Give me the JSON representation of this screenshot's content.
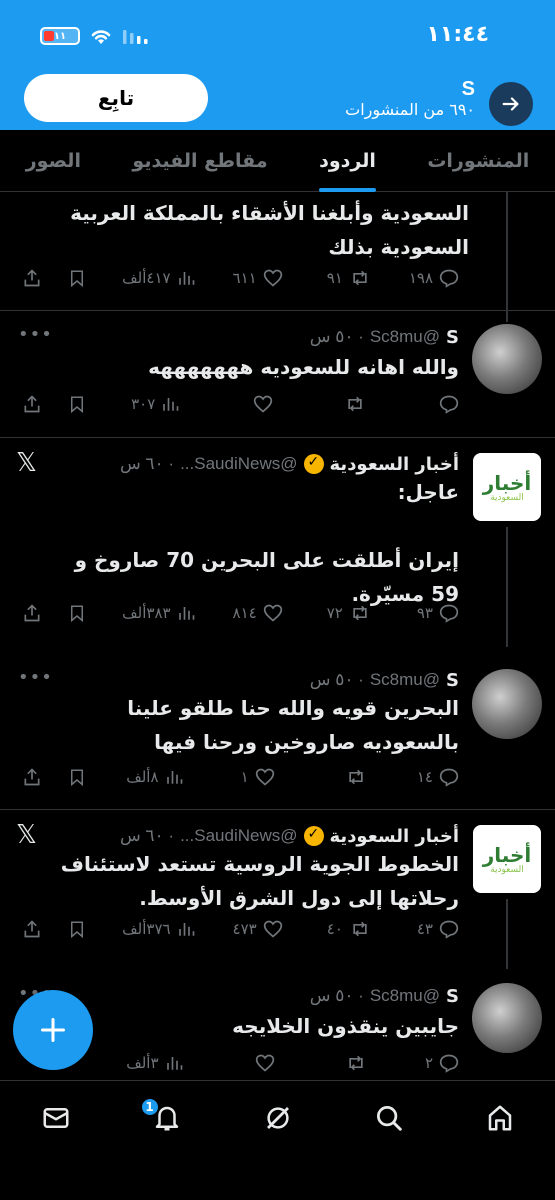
{
  "status_bar": {
    "time": "١١:٤٤",
    "battery": "١١"
  },
  "profile": {
    "name": "S",
    "post_count": "٦٩٠ من المنشورات",
    "follow_label": "تابِع"
  },
  "tabs": [
    {
      "label": "المنشورات",
      "active": false
    },
    {
      "label": "الردود",
      "active": true
    },
    {
      "label": "مقاطع الفيديو",
      "active": false
    },
    {
      "label": "الصور",
      "active": false
    }
  ],
  "posts": [
    {
      "body": "السعودية وأبلغنا الأشقاء بالمملكة العربية السعودية بذلك",
      "replies": "١٩٨",
      "reposts": "٩١",
      "likes": "٦١١",
      "views": "٤١٧ألف"
    },
    {
      "author": "S",
      "handle": "@Sc8mu",
      "time": "· ٥٠ س",
      "body": "والله اهانه للسعوديه هههههههه",
      "replies": "",
      "reposts": "",
      "likes": "",
      "views": "٣٠٧"
    },
    {
      "author": "أخبار السعودية",
      "handle": "@SaudiNews...",
      "time": "· ٦٠ س",
      "body": "عاجل:\n\nإيران أطلقت على البحرين 70 صاروخ و 59 مسيّرة.",
      "replies": "٩٣",
      "reposts": "٧٢",
      "likes": "٨١٤",
      "views": "٣٨٣ألف"
    },
    {
      "author": "S",
      "handle": "@Sc8mu",
      "time": "· ٥٠ س",
      "body": "البحرين قويه والله حنا طلقو علينا بالسعوديه صاروخين ورحنا فيها",
      "replies": "١٤",
      "reposts": "",
      "likes": "١",
      "views": "٨ألف"
    },
    {
      "author": "أخبار السعودية",
      "handle": "@SaudiNews...",
      "time": "· ٦٠ س",
      "body": "الخطوط الجوية الروسية تستعد لاستئناف رحلاتها إلى دول الشرق الأوسط.",
      "replies": "٤٣",
      "reposts": "٤٠",
      "likes": "٤٧٣",
      "views": "٣٧٦ألف"
    },
    {
      "author": "S",
      "handle": "@Sc8mu",
      "time": "· ٥٠ س",
      "body": "جايبين ينقذون الخلايجه",
      "replies": "٢",
      "reposts": "",
      "likes": "",
      "views": "٣ألف"
    }
  ],
  "avatars": {
    "news_logo_main": "أخبار",
    "news_logo_sub": "السعودية"
  },
  "bottom_nav": {
    "notifications_badge": "1"
  },
  "colors": {
    "accent": "#1d9bf0",
    "background": "#000000",
    "verified": "#f7b500"
  }
}
